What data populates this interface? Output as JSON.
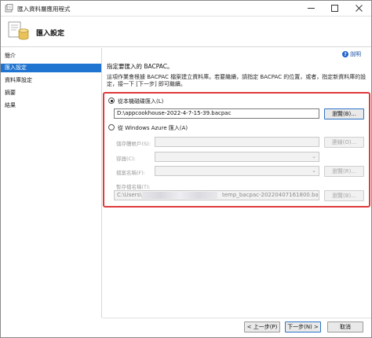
{
  "window": {
    "title": "匯入資料層應用程式"
  },
  "header": {
    "title": "匯入設定"
  },
  "nav": {
    "items": [
      {
        "label": "簡介",
        "selected": false
      },
      {
        "label": "匯入設定",
        "selected": true
      },
      {
        "label": "資料庫設定",
        "selected": false
      },
      {
        "label": "摘要",
        "selected": false
      },
      {
        "label": "結果",
        "selected": false
      }
    ]
  },
  "help": {
    "label": "說明"
  },
  "content": {
    "heading": "指定要匯入的 BACPAC。",
    "description": "這項作業會根據 BACPAC 檔案建立資料庫。若要繼續，請指定 BACPAC 的位置，或者，指定新資料庫的設定，接一下 [下一步] 即可繼續。"
  },
  "local": {
    "radio_label": "從本機磁碟匯入(L)",
    "path_value": "D:\\appcookhouse-2022-4-7-15-39.bacpac",
    "browse_label": "瀏覽(B)..."
  },
  "azure": {
    "radio_label": "從 Windows Azure 匯入(A)",
    "storage_account_label": "儲存體帳戶(S):",
    "connect_label": "連線(O)...",
    "container_label": "容器(C):",
    "filename_label": "檔案名稱(F):",
    "browse_label": "瀏覽(R)...",
    "temp_filename_label": "暫存檔名稱(T):",
    "temp_path_prefix": "C:\\Users\\",
    "temp_path_suffix": "temp_bacpac-20220407161800.bacpac",
    "browse2_label": "瀏覽(B)..."
  },
  "footer": {
    "prev_label": "< 上一步(P)",
    "next_label": "下一步(N) >",
    "cancel_label": "取消"
  }
}
